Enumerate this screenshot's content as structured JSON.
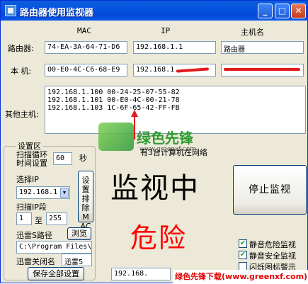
{
  "window": {
    "title": "路由器使用监视器"
  },
  "titlebar_buttons": {
    "minimize": "_",
    "maximize": "□",
    "close": "✕"
  },
  "headers": {
    "mac": "MAC",
    "ip": "IP",
    "host": "主机名"
  },
  "router": {
    "label": "路由器:",
    "mac": "74-EA-3A-64-71-D6",
    "ip": "192.168.1.1",
    "host": "路由器"
  },
  "local": {
    "label": "本  机:",
    "mac": "00-E0-4C-C6-68-E9",
    "ip": "192.168.1."
  },
  "other_hosts": {
    "label": "其他主机:",
    "rows": [
      "192.168.1.100 00-24-25-07-55-82",
      "192.168.1.101 00-E0-4C-00-21-78",
      "192.168.1.103 1C-6F-65-42-FF-FB"
    ]
  },
  "status": {
    "count_text": "有3台计算机在网络"
  },
  "settings": {
    "group_title": "设置区",
    "scan_cycle_label": "扫描循环时间设置",
    "scan_cycle_value": "60",
    "seconds_unit": "秒",
    "select_ip_label": "选择IP",
    "select_ip_value": "192.168.1",
    "set_exclude_mac_button": "设置排除MAC",
    "scan_ip_range_label": "扫描IP段",
    "ip_from": "1",
    "ip_to_label": "至",
    "ip_to": "255",
    "xunlei_path_label": "迅雷S路径",
    "browse_button": "浏览",
    "xunlei_path_value": "C:\\Program Files\\T",
    "xunlei_close_label": "迅雷关闭名",
    "xunlei_close_value": "迅雷5",
    "save_all_button": "保存全部设置"
  },
  "monitor": {
    "status_big": "监视中",
    "danger_big": "危险",
    "stop_button": "停止监视",
    "bottom_ip": "192.168."
  },
  "options": {
    "mute_danger": "静音危险监视",
    "mute_safe": "静音安全监视",
    "flash_icon": "闪烁图标警示"
  },
  "watermark": {
    "brand": "绿色先锋",
    "url": "www.greenxf.com",
    "banner": "绿色先锋下载(www.greenxf.com)"
  },
  "colors": {
    "danger": "#ff0000",
    "title_bar": "#0854e3"
  }
}
